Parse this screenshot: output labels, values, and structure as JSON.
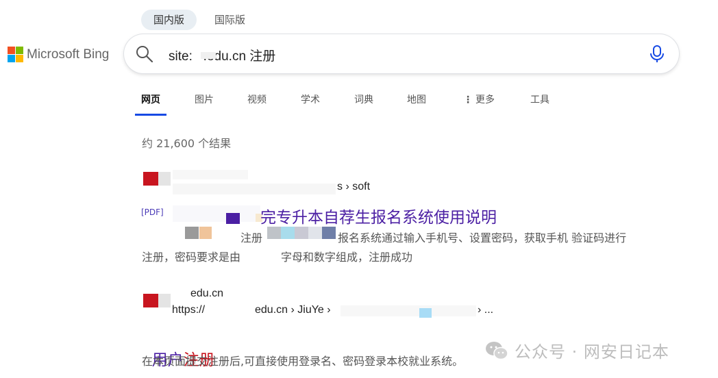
{
  "region_tabs": [
    {
      "label": "国内版",
      "active": true
    },
    {
      "label": "国际版",
      "active": false
    }
  ],
  "logo": {
    "text": "Microsoft Bing",
    "colors": [
      "#f25022",
      "#7fba00",
      "#00a4ef",
      "#ffb900"
    ]
  },
  "search": {
    "query": "site:   .edu.cn 注册"
  },
  "scope_tabs": [
    {
      "label": "网页",
      "active": true
    },
    {
      "label": "图片"
    },
    {
      "label": "视频"
    },
    {
      "label": "学术"
    },
    {
      "label": "词典"
    },
    {
      "label": "地图"
    },
    {
      "label": "更多"
    },
    {
      "label": "工具"
    }
  ],
  "result_count": "约 21,600 个结果",
  "results": [
    {
      "site_path": "s › soft",
      "tag": "[PDF]",
      "title": "完专升本自荐生报名系统使用说明",
      "snippet_line1_a": "注册",
      "snippet_line1_b": "报名系统通过输入手机号、设置密码，获取手机 验证码进行",
      "snippet_line2_a": "注册，密码要求是由",
      "snippet_line2_b": "字母和数字组成，注册成功"
    },
    {
      "site_name": "edu.cn",
      "url_a": "https://",
      "url_b": "edu.cn › JiuYe ›",
      "url_c": "› ...",
      "title_a": "用户",
      "title_b": "注册",
      "snippet": "在本页面提交注册后,可直接使用登录名、密码登录本校就业系统。"
    }
  ],
  "watermark": "公众号 · 网安日记本",
  "colors": {
    "link_visited": "#4b1fa3",
    "highlight": "#c8151f",
    "accent": "#174ae4"
  }
}
